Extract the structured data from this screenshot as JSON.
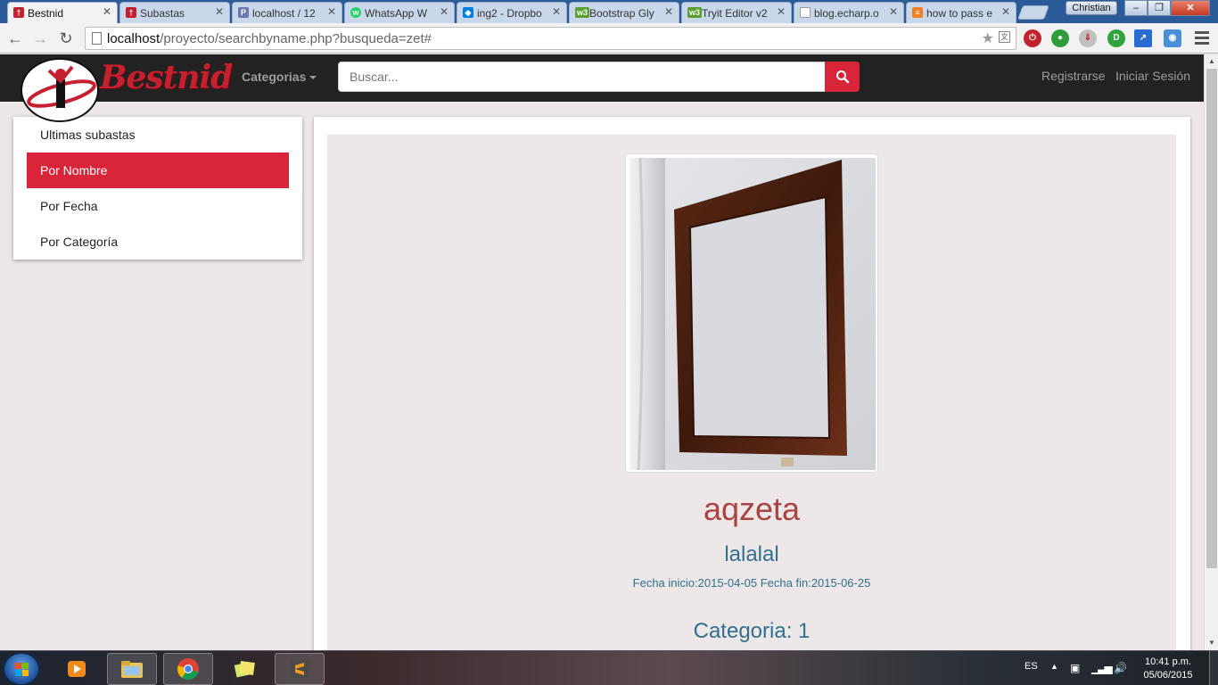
{
  "browser": {
    "tabs": [
      {
        "title": "Bestnid",
        "favicon_color": "#c6202f",
        "active": true
      },
      {
        "title": "Subastas",
        "favicon_color": "#c6202f",
        "active": false
      },
      {
        "title": "localhost / 12",
        "favicon_color": "#6c78af",
        "active": false
      },
      {
        "title": "WhatsApp W",
        "favicon_color": "#25d366",
        "active": false
      },
      {
        "title": "ing2 - Dropbo",
        "favicon_color": "#007ee5",
        "active": false
      },
      {
        "title": "Bootstrap Gly",
        "favicon_color": "#5aa02c",
        "active": false
      },
      {
        "title": "Tryit Editor v2",
        "favicon_color": "#5aa02c",
        "active": false
      },
      {
        "title": "blog.echarp.o",
        "favicon_color": "#999999",
        "active": false
      },
      {
        "title": "how to pass e",
        "favicon_color": "#f48024",
        "active": false
      }
    ],
    "profile_name": "Christian",
    "url_host": "localhost",
    "url_path": "/proyecto/searchbyname.php?busqueda=zet#"
  },
  "site": {
    "brand": "Bestnid",
    "brand_color": "#c6202f",
    "categories_label": "Categorias",
    "search_placeholder": "Buscar...",
    "register_label": "Registrarse",
    "login_label": "Iniciar Sesión"
  },
  "sidebar": {
    "items": [
      {
        "label": "Ultimas subastas",
        "active": false
      },
      {
        "label": "Por Nombre",
        "active": true
      },
      {
        "label": "Por Fecha",
        "active": false
      },
      {
        "label": "Por Categoría",
        "active": false
      }
    ]
  },
  "item": {
    "title": "aqzeta",
    "description": "lalalal",
    "dates": "Fecha inicio:2015-04-05 Fecha fin:2015-06-25",
    "category": "Categoria: 1"
  },
  "taskbar": {
    "language": "ES",
    "time": "10:41 p.m.",
    "date": "05/06/2015"
  },
  "colors": {
    "accent": "#d9253a",
    "navbar_bg": "#222222",
    "title_color": "#a94442",
    "info_color": "#31708f"
  }
}
